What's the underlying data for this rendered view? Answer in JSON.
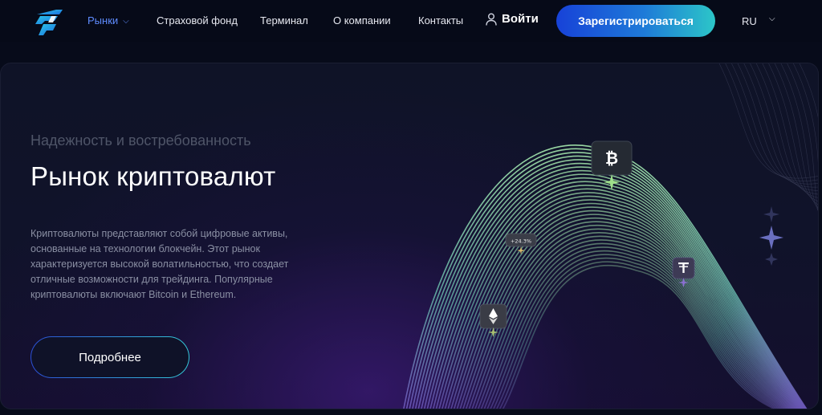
{
  "header": {
    "nav": [
      {
        "label": "Рынки",
        "active": true,
        "has_dropdown": true
      },
      {
        "label": "Страховой фонд"
      },
      {
        "label": "Терминал"
      },
      {
        "label": "О компании"
      },
      {
        "label": "Контакты"
      }
    ],
    "login_label": "Войти",
    "register_label": "Зарегистрироваться",
    "language": "RU",
    "icons": {
      "logo": "brand-logo",
      "user": "user-icon",
      "chevron": "chevron-down-icon"
    }
  },
  "hero": {
    "subtitle": "Надежность и востребованность",
    "title": "Рынок криптовалют",
    "description": "Криптовалюты представляют собой цифровые активы, основанные на технологии блокчейн. Этот рынок характеризуется высокой волатильностью, что создает отличные возможности для трейдинга. Популярные криптовалюты включают Bitcoin и Ethereum.",
    "cta_label": "Подробнее",
    "badges": {
      "percent_label": "+24.3%",
      "coins": [
        "bitcoin-icon",
        "tether-icon",
        "ethereum-icon"
      ]
    }
  },
  "colors": {
    "background": "#070b1a",
    "accent_nav": "#5f8cff",
    "button_gradient_start": "#1742d8",
    "button_gradient_end": "#2cc6c8",
    "wave_green": "#8fd7a0",
    "wave_purple": "#6b4fb8"
  }
}
